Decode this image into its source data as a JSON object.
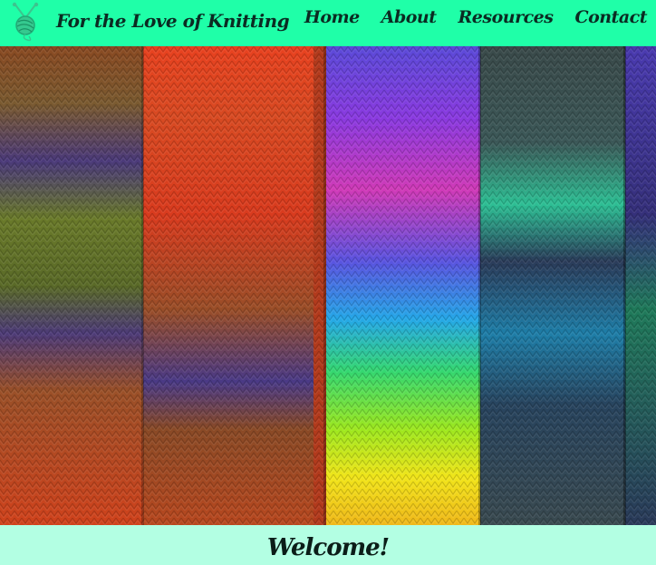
{
  "site": {
    "title": "For the Love of Knitting"
  },
  "logo": {
    "icon": "yarn-ball-with-needles-icon"
  },
  "nav": {
    "items": [
      {
        "label": "Home"
      },
      {
        "label": "About"
      },
      {
        "label": "Resources"
      },
      {
        "label": "Contact"
      }
    ]
  },
  "hero": {
    "image": "knitted-scarves-multicolor-photo"
  },
  "main": {
    "heading": "Welcome!"
  },
  "colors": {
    "header_bg": "#1fffa8",
    "page_bg": "#b3ffe3",
    "text": "#0b2b22"
  }
}
